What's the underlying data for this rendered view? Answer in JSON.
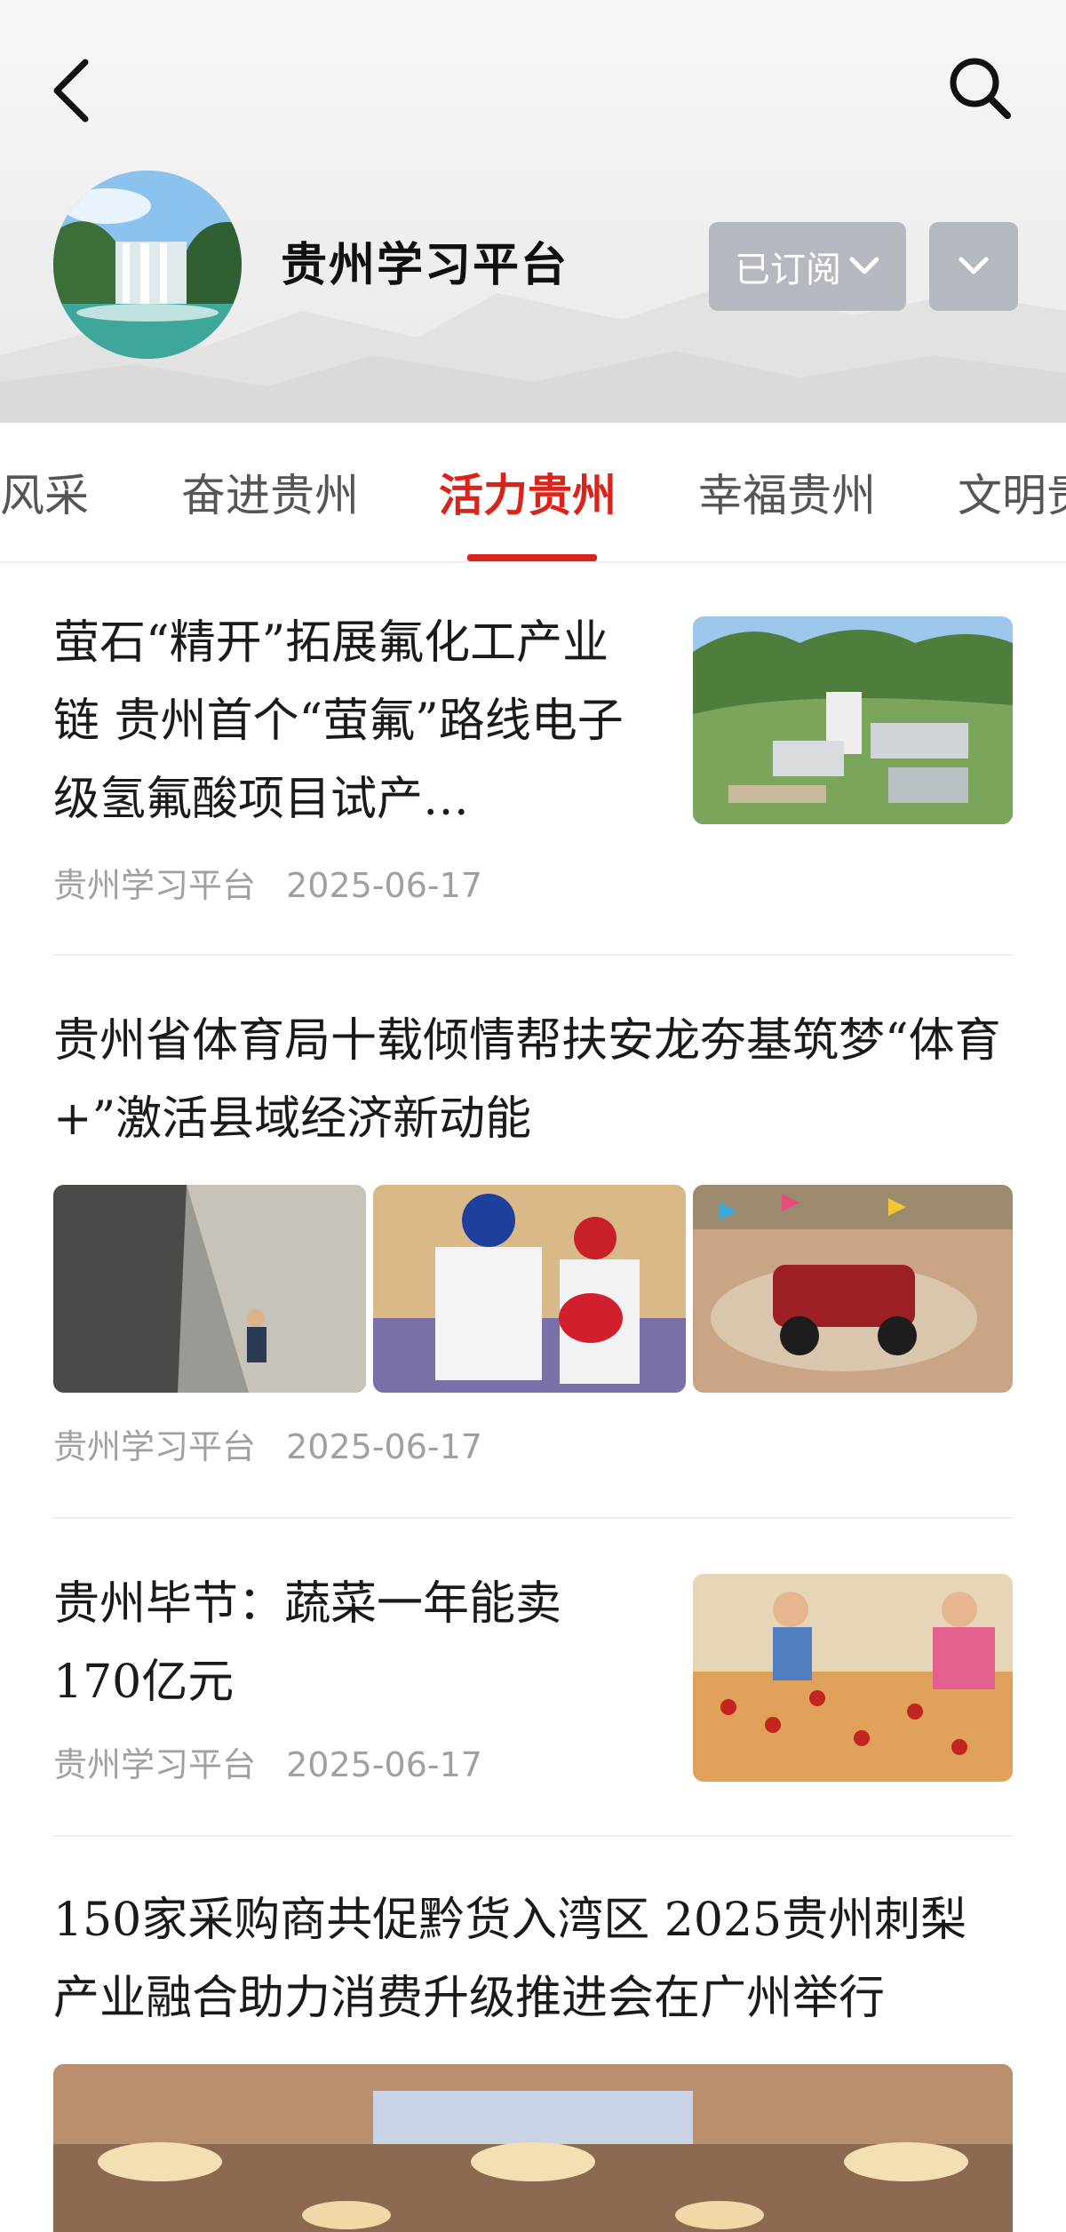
{
  "header": {
    "channel_name": "贵州学习平台",
    "subscribe_label": "已订阅",
    "icons": {
      "back": "back-arrow-icon",
      "search": "search-icon",
      "more": "chevron-down-icon"
    }
  },
  "tabs": [
    {
      "label": "新风采",
      "active": false
    },
    {
      "label": "奋进贵州",
      "active": false
    },
    {
      "label": "活力贵州",
      "active": true
    },
    {
      "label": "幸福贵州",
      "active": false
    },
    {
      "label": "文明贵州",
      "active": false
    }
  ],
  "articles": [
    {
      "title": "萤石“精开”拓展氟化工产业链 贵州首个“萤氟”路线电子级氢氟酸项目试产…",
      "source": "贵州学习平台",
      "date": "2025-06-17"
    },
    {
      "title": "贵州省体育局十载倾情帮扶安龙夯基筑梦“体育+”激活县域经济新动能",
      "source": "贵州学习平台",
      "date": "2025-06-17"
    },
    {
      "title": "贵州毕节：蔬菜一年能卖170亿元",
      "source": "贵州学习平台",
      "date": "2025-06-17"
    },
    {
      "title": "150家采购商共促黔货入湾区 2025贵州刺梨产业融合助力消费升级推进会在广州举行"
    }
  ],
  "colors": {
    "accent": "#d8241b",
    "button_gray": "#b4b8bf"
  }
}
